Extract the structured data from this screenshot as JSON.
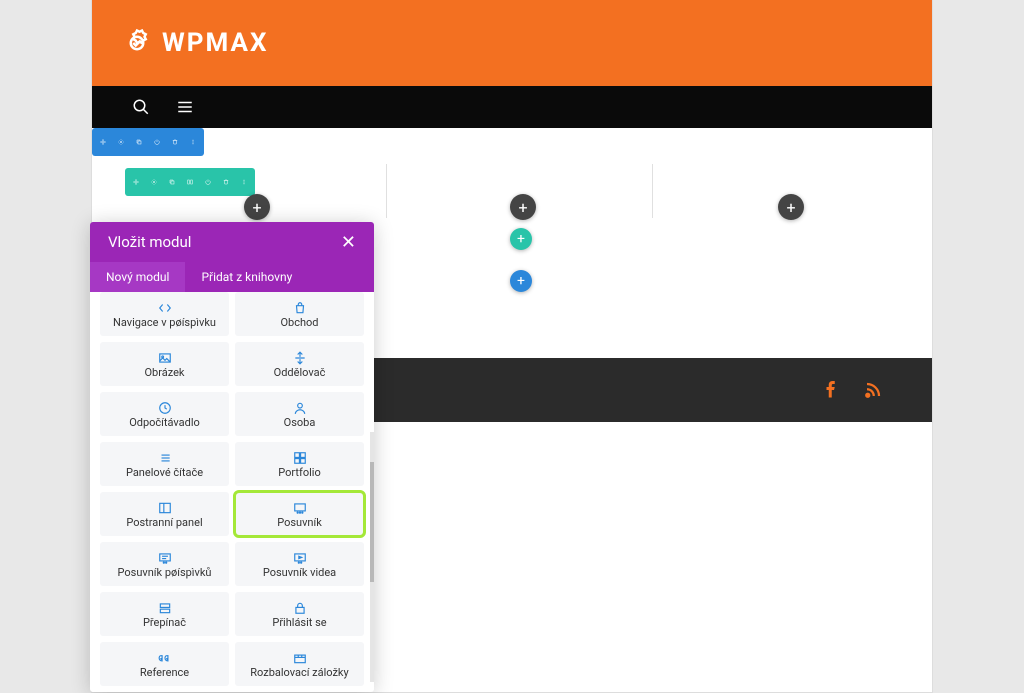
{
  "brand": {
    "name": "WPMAX"
  },
  "section_toolbar": {
    "icons": [
      "move",
      "gear",
      "dup",
      "power",
      "trash",
      "dots"
    ]
  },
  "row_toolbar": {
    "icons": [
      "move",
      "gear",
      "dup",
      "cols",
      "power",
      "trash",
      "dots"
    ]
  },
  "popup": {
    "title": "Vložit modul",
    "tabs": {
      "new": "Nový modul",
      "library": "Přidat z knihovny"
    },
    "modules": [
      {
        "label": "Navigace v pøíspìvku",
        "icon": "code"
      },
      {
        "label": "Obchod",
        "icon": "bag"
      },
      {
        "label": "Obrázek",
        "icon": "image"
      },
      {
        "label": "Oddělovač",
        "icon": "divider"
      },
      {
        "label": "Odpočítávadlo",
        "icon": "clock"
      },
      {
        "label": "Osoba",
        "icon": "person"
      },
      {
        "label": "Panelové čítače",
        "icon": "list"
      },
      {
        "label": "Portfolio",
        "icon": "grid"
      },
      {
        "label": "Postranní panel",
        "icon": "sidepanel"
      },
      {
        "label": "Posuvník",
        "icon": "slider",
        "highlighted": true
      },
      {
        "label": "Posuvník pøíspìvků",
        "icon": "slider2"
      },
      {
        "label": "Posuvník videa",
        "icon": "video"
      },
      {
        "label": "Přepínač",
        "icon": "toggle"
      },
      {
        "label": "Přihlásit se",
        "icon": "lock"
      },
      {
        "label": "Reference",
        "icon": "quote"
      },
      {
        "label": "Rozbalovací záložky",
        "icon": "tabs"
      }
    ]
  }
}
